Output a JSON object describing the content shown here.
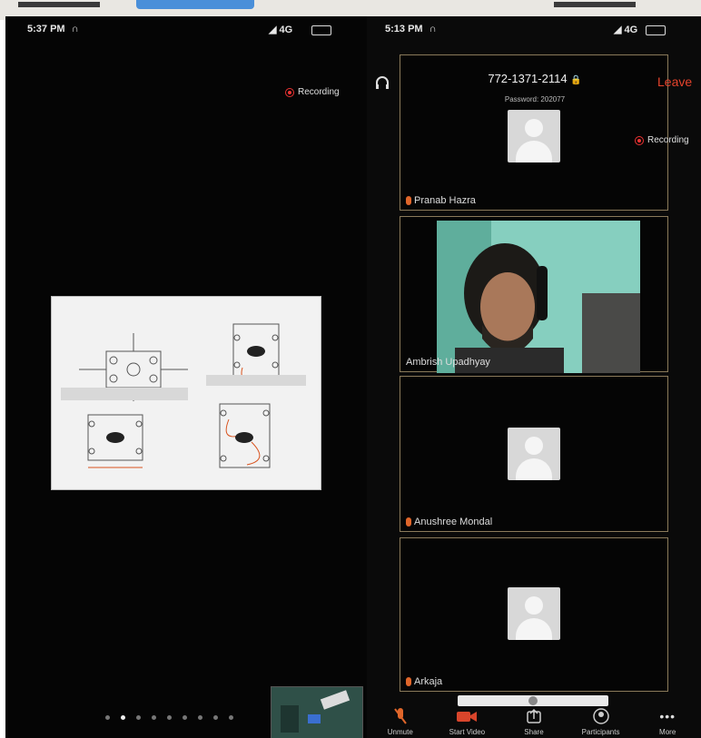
{
  "left_phone": {
    "status_time": "5:37 PM",
    "status_right": "4G",
    "recording_label": "Recording",
    "page_dots": 9,
    "active_dot": 1
  },
  "right_phone": {
    "status_time": "5:13 PM",
    "status_right": "4G",
    "meeting_id": "772-1371-2114",
    "password": "Password: 202077",
    "leave_label": "Leave",
    "recording_label": "Recording",
    "participants": [
      {
        "name": "Pranab Hazra",
        "muted": true,
        "video": false
      },
      {
        "name": "Ambrish Upadhyay",
        "muted": false,
        "video": true
      },
      {
        "name": "Anushree Mondal",
        "muted": true,
        "video": false
      },
      {
        "name": "Arkaja",
        "muted": true,
        "video": false
      }
    ],
    "toolbar": {
      "unmute": "Unmute",
      "start_video": "Start Video",
      "share": "Share",
      "participants": "Participants",
      "more": "More"
    }
  },
  "colors": {
    "background": "#050505",
    "recording": "#e33333",
    "leave": "#e5432c",
    "muted_mic": "#e0662a"
  }
}
